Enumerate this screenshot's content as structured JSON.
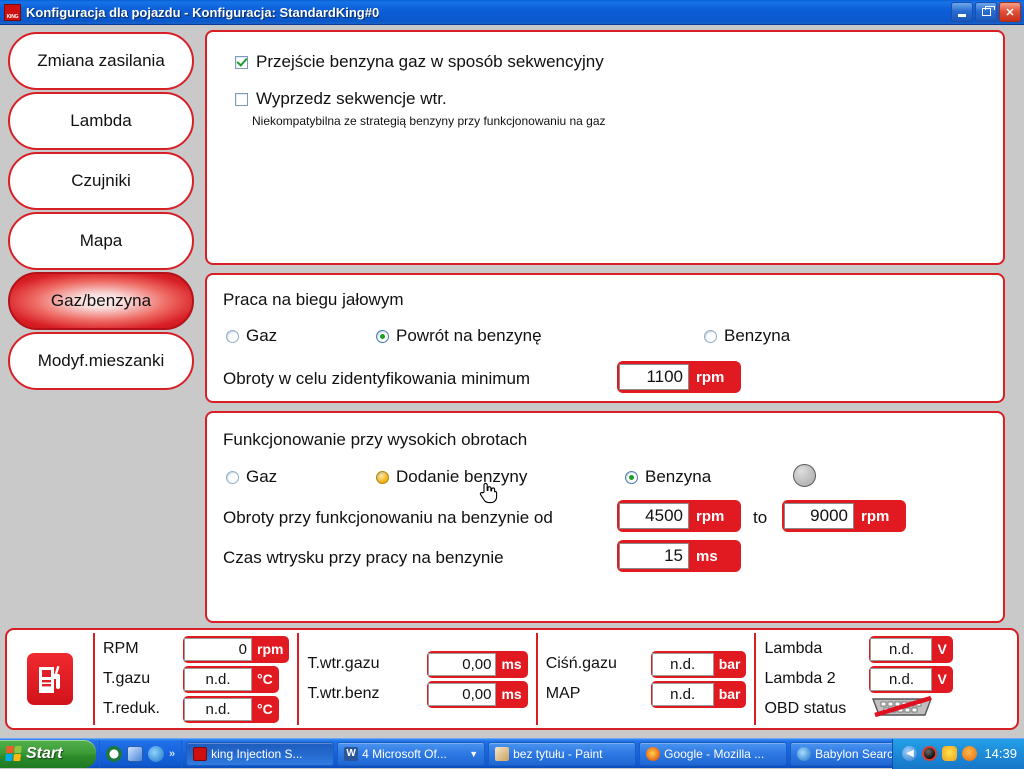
{
  "window": {
    "title": "Konfiguracja dla pojazdu - Konfiguracja: StandardKing#0",
    "icon": "app-icon-king",
    "minimize_label": "Minimize",
    "maximize_label": "Maximize",
    "close_label": "✕"
  },
  "sidebar": {
    "items": [
      {
        "label": "Zmiana zasilania",
        "active": false
      },
      {
        "label": "Lambda",
        "active": false
      },
      {
        "label": "Czujniki",
        "active": false
      },
      {
        "label": "Mapa",
        "active": false
      },
      {
        "label": "Gaz/benzyna",
        "active": true
      },
      {
        "label": "Modyf.mieszanki",
        "active": false
      }
    ]
  },
  "sequence_panel": {
    "checkbox1_label": "Przejście benzyna gaz w sposób sekwencyjny",
    "checkbox1_checked": true,
    "checkbox2_label": "Wyprzedz sekwencje wtr.",
    "checkbox2_checked": false,
    "checkbox2_note": "Niekompatybilna ze strategią benzyny przy funkcjonowaniu na gaz"
  },
  "idle_panel": {
    "title": "Praca na biegu jałowym",
    "radios": [
      {
        "label": "Gaz",
        "state": "off"
      },
      {
        "label": "Powrót na benzynę",
        "state": "selected"
      },
      {
        "label": "Benzyna",
        "state": "off"
      }
    ],
    "rpm_label": "Obroty w celu zidentyfikowania minimum",
    "rpm_value": "1100",
    "rpm_unit": "rpm"
  },
  "high_rpm_panel": {
    "title": "Funkcjonowanie przy wysokich obrotach",
    "radios": [
      {
        "label": "Gaz",
        "state": "off"
      },
      {
        "label": "Dodanie benzyny",
        "state": "hover"
      },
      {
        "label": "Benzyna",
        "state": "selected"
      }
    ],
    "led_name": "status-led-grey",
    "range_label": "Obroty przy funkcjonowaniu na benzynie  od",
    "range_from_value": "4500",
    "range_from_unit": "rpm",
    "range_to_label": "to",
    "range_to_value": "9000",
    "range_to_unit": "rpm",
    "inj_label": "Czas wtrysku przy pracy na benzynie",
    "inj_value": "15",
    "inj_unit": "ms"
  },
  "statusbar": {
    "icon": "fuel-pump-icon",
    "group1": [
      {
        "name": "RPM",
        "value": "0",
        "unit": "rpm"
      },
      {
        "name": "T.gazu",
        "value": "n.d.",
        "unit": "°C"
      },
      {
        "name": "T.reduk.",
        "value": "n.d.",
        "unit": "°C"
      }
    ],
    "group2": [
      {
        "name": "T.wtr.gazu",
        "value": "0,00",
        "unit": "ms"
      },
      {
        "name": "T.wtr.benz",
        "value": "0,00",
        "unit": "ms"
      }
    ],
    "group3": [
      {
        "name": "Ciśń.gazu",
        "value": "n.d.",
        "unit": "bar"
      },
      {
        "name": "MAP",
        "value": "n.d.",
        "unit": "bar"
      }
    ],
    "group4": [
      {
        "name": "Lambda",
        "value": "n.d.",
        "unit": "V"
      },
      {
        "name": "Lambda 2",
        "value": "n.d.",
        "unit": "V"
      }
    ],
    "obd_label": "OBD status",
    "obd_icon": "obd-connector-disconnected-icon"
  },
  "taskbar": {
    "start_label": "Start",
    "quicklaunch_more": "»",
    "tasks": [
      {
        "label": "king Injection S...",
        "icon": "king-icon",
        "active": true
      },
      {
        "label": "4 Microsoft Of...",
        "icon": "word-icon",
        "active": false,
        "has_arrow": true
      },
      {
        "label": "bez tytułu - Paint",
        "icon": "paint-icon",
        "active": false
      },
      {
        "label": "Google - Mozilla ...",
        "icon": "firefox-icon",
        "active": false
      },
      {
        "label": "Babylon Search ...",
        "icon": "ie-icon",
        "active": false
      }
    ],
    "clock": "14:39"
  },
  "colors": {
    "accent_red": "#e11a22",
    "border_red": "#d81f26",
    "background": "#c9c9c9",
    "titlebar_blue": "#0d5fd8",
    "check_green": "#18a02a",
    "hover_orange": "#f4b824"
  }
}
